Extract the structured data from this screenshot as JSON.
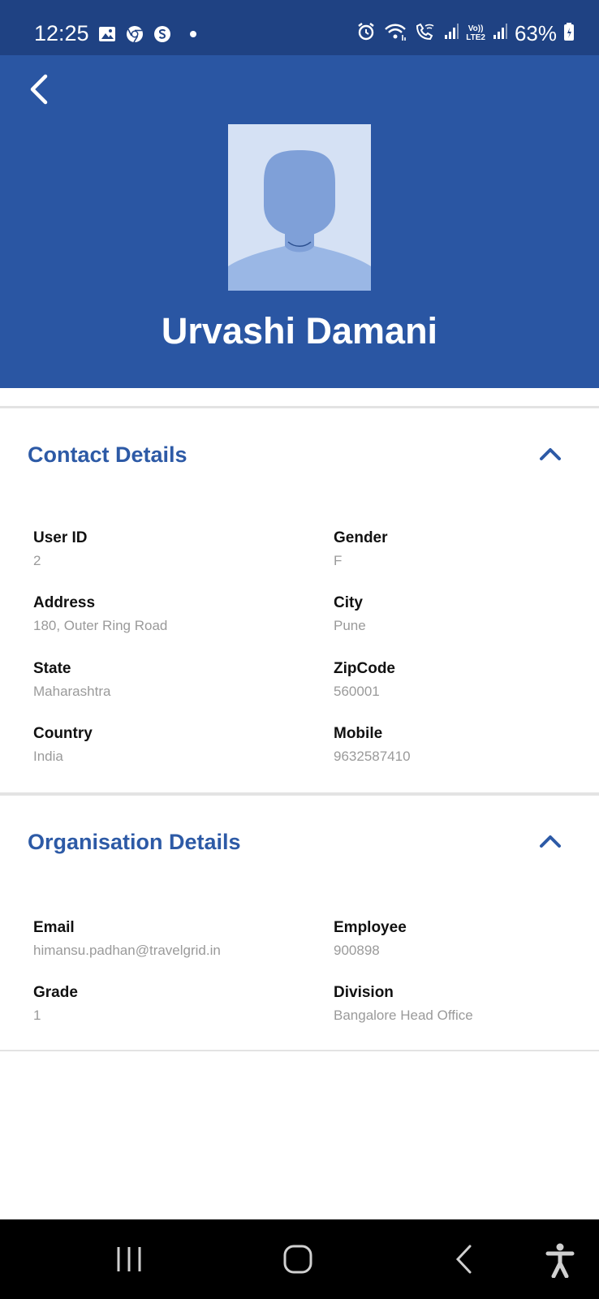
{
  "status_bar": {
    "time": "12:25",
    "battery": "63%",
    "icons_left": [
      "gallery-icon",
      "chrome-icon",
      "s-app-icon",
      "notification-dot"
    ],
    "icons_right": [
      "alarm-icon",
      "wifi-icon",
      "wifi-call-icon",
      "signal-1-icon",
      "volte-icon",
      "signal-2-icon",
      "battery-icon"
    ],
    "volte_label_top": "Vo))",
    "volte_label_bottom": "LTE2"
  },
  "header": {
    "name": "Urvashi Damani",
    "background_color": "#2a56a3"
  },
  "contact_section": {
    "title": "Contact Details",
    "fields": [
      {
        "label": "User ID",
        "value": "2"
      },
      {
        "label": "Gender",
        "value": "F"
      },
      {
        "label": "Address",
        "value": "180, Outer Ring Road"
      },
      {
        "label": "City",
        "value": "Pune"
      },
      {
        "label": "State",
        "value": "Maharashtra"
      },
      {
        "label": "ZipCode",
        "value": "560001"
      },
      {
        "label": "Country",
        "value": "India"
      },
      {
        "label": "Mobile",
        "value": "9632587410"
      }
    ]
  },
  "organisation_section": {
    "title": "Organisation Details",
    "fields": [
      {
        "label": "Email",
        "value": "himansu.padhan@travelgrid.in"
      },
      {
        "label": "Employee",
        "value": "900898"
      },
      {
        "label": "Grade",
        "value": "1"
      },
      {
        "label": "Division",
        "value": "Bangalore Head Office"
      }
    ]
  },
  "nav_bar": {
    "buttons": [
      "recent-apps-icon",
      "home-icon",
      "back-icon",
      "accessibility-icon"
    ]
  },
  "colors": {
    "accent": "#2d5aa6",
    "status_bar": "#1f4283",
    "label": "#111111",
    "value": "#9a9a9a"
  }
}
